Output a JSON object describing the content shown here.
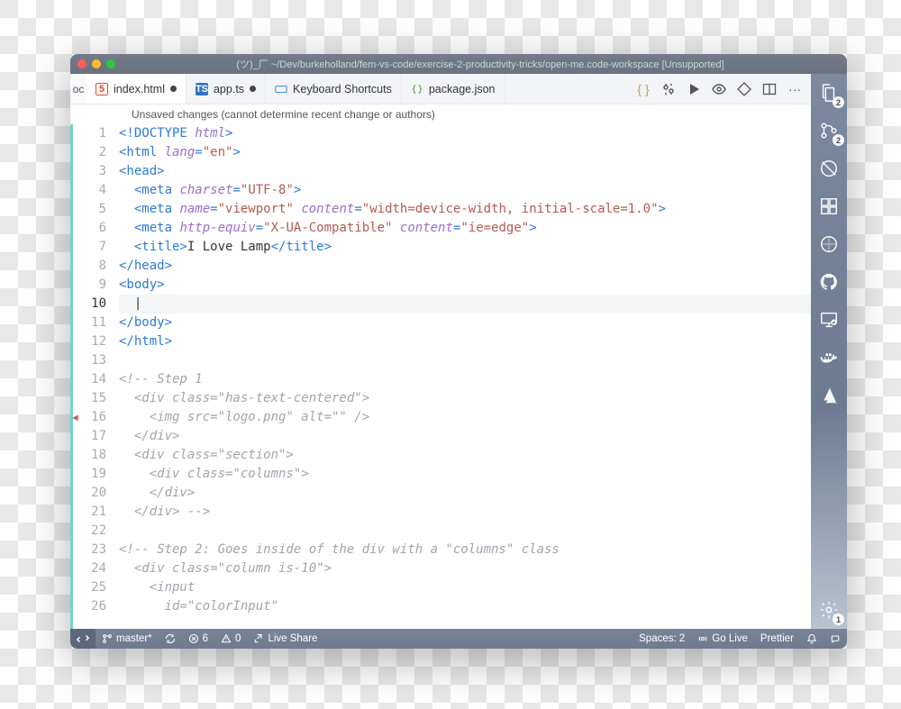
{
  "titlebar": {
    "title": "(ツ)_厂 ~/Dev/burkeholland/fem-vs-code/exercise-2-productivity-tricks/open-me.code-workspace [Unsupported]"
  },
  "tabs": {
    "prefix": "oc",
    "items": [
      {
        "label": "index.html",
        "dirty": true,
        "icon": "html5",
        "active": true
      },
      {
        "label": "app.ts",
        "dirty": true,
        "icon": "ts"
      },
      {
        "label": "Keyboard Shortcuts",
        "dirty": false,
        "icon": "keyboard"
      },
      {
        "label": "package.json",
        "dirty": false,
        "icon": "json"
      }
    ],
    "actions": [
      "braces",
      "compare",
      "run",
      "preview",
      "diff",
      "split",
      "more"
    ]
  },
  "info_bar": "Unsaved changes (cannot determine recent change or authors)",
  "editor": {
    "lines": [
      {
        "n": 1,
        "html": "<span class='tok-tag'>&lt;!DOCTYPE </span><span class='tok-dt-kw'>html</span><span class='tok-tag'>&gt;</span>"
      },
      {
        "n": 2,
        "html": "<span class='tok-tag'>&lt;html </span><span class='tok-attr'>lang</span><span class='tok-tag'>=</span><span class='tok-str'>\"en\"</span><span class='tok-tag'>&gt;</span>"
      },
      {
        "n": 3,
        "html": "<span class='tok-tag'>&lt;head&gt;</span>"
      },
      {
        "n": 4,
        "html": "  <span class='tok-tag'>&lt;meta </span><span class='tok-attr'>charset</span><span class='tok-tag'>=</span><span class='tok-str'>\"UTF-8\"</span><span class='tok-tag'>&gt;</span>"
      },
      {
        "n": 5,
        "html": "  <span class='tok-tag'>&lt;meta </span><span class='tok-attr'>name</span><span class='tok-tag'>=</span><span class='tok-str'>\"viewport\"</span> <span class='tok-attr'>content</span><span class='tok-tag'>=</span><span class='tok-str'>\"width=device-width, initial-scale=1.0\"</span><span class='tok-tag'>&gt;</span>"
      },
      {
        "n": 6,
        "html": "  <span class='tok-tag'>&lt;meta </span><span class='tok-attr'>http-equiv</span><span class='tok-tag'>=</span><span class='tok-str'>\"X-UA-Compatible\"</span> <span class='tok-attr'>content</span><span class='tok-tag'>=</span><span class='tok-str'>\"ie=edge\"</span><span class='tok-tag'>&gt;</span>"
      },
      {
        "n": 7,
        "html": "  <span class='tok-tag'>&lt;title&gt;</span><span class='tok-txt'>I Love Lamp</span><span class='tok-tag'>&lt;/title&gt;</span>"
      },
      {
        "n": 8,
        "html": "<span class='tok-tag'>&lt;/head&gt;</span>"
      },
      {
        "n": 9,
        "html": "<span class='tok-tag'>&lt;body&gt;</span>"
      },
      {
        "n": 10,
        "html": "  <span class='tok-txt'>|</span>",
        "cursor": true
      },
      {
        "n": 11,
        "html": "<span class='tok-tag'>&lt;/body&gt;</span>"
      },
      {
        "n": 12,
        "html": "<span class='tok-tag'>&lt;/html&gt;</span>"
      },
      {
        "n": 13,
        "html": ""
      },
      {
        "n": 14,
        "html": "<span class='tok-comment'>&lt;!-- Step 1</span>"
      },
      {
        "n": 15,
        "html": "<span class='tok-comment'>  &lt;div class=\"has-text-centered\"&gt;</span>"
      },
      {
        "n": 16,
        "html": "<span class='tok-comment'>    &lt;img src=\"logo.png\" alt=\"\" /&gt;</span>"
      },
      {
        "n": 17,
        "html": "<span class='tok-comment'>  &lt;/div&gt;</span>"
      },
      {
        "n": 18,
        "html": "<span class='tok-comment'>  &lt;div class=\"section\"&gt;</span>"
      },
      {
        "n": 19,
        "html": "<span class='tok-comment'>    &lt;div class=\"columns\"&gt;</span>"
      },
      {
        "n": 20,
        "html": "<span class='tok-comment'>    &lt;/div&gt;</span>"
      },
      {
        "n": 21,
        "html": "<span class='tok-comment'>  &lt;/div&gt; --&gt;</span>"
      },
      {
        "n": 22,
        "html": ""
      },
      {
        "n": 23,
        "html": "<span class='tok-comment'>&lt;!-- Step 2: Goes inside of the div with a \"columns\" class</span>"
      },
      {
        "n": 24,
        "html": "<span class='tok-comment'>  &lt;div class=\"column is-10\"&gt;</span>"
      },
      {
        "n": 25,
        "html": "<span class='tok-comment'>    &lt;input</span>"
      },
      {
        "n": 26,
        "html": "<span class='tok-comment'>      id=\"colorInput\"</span>"
      }
    ]
  },
  "activity": {
    "items": [
      {
        "name": "files-icon",
        "badge": "2"
      },
      {
        "name": "source-control-icon",
        "badge": "2"
      },
      {
        "name": "debug-icon"
      },
      {
        "name": "extensions-icon"
      },
      {
        "name": "no-symbol-icon"
      },
      {
        "name": "github-icon"
      },
      {
        "name": "remote-explorer-icon"
      },
      {
        "name": "docker-icon"
      },
      {
        "name": "azure-icon"
      }
    ],
    "bottom": [
      {
        "name": "settings-gear-icon",
        "badge": "1"
      }
    ]
  },
  "statusbar": {
    "left": {
      "branch": "master*",
      "sync": "↻",
      "errors": "6",
      "warnings": "0",
      "live_share": "Live Share"
    },
    "right": {
      "spaces": "Spaces: 2",
      "go_live": "Go Live",
      "prettier": "Prettier"
    }
  }
}
